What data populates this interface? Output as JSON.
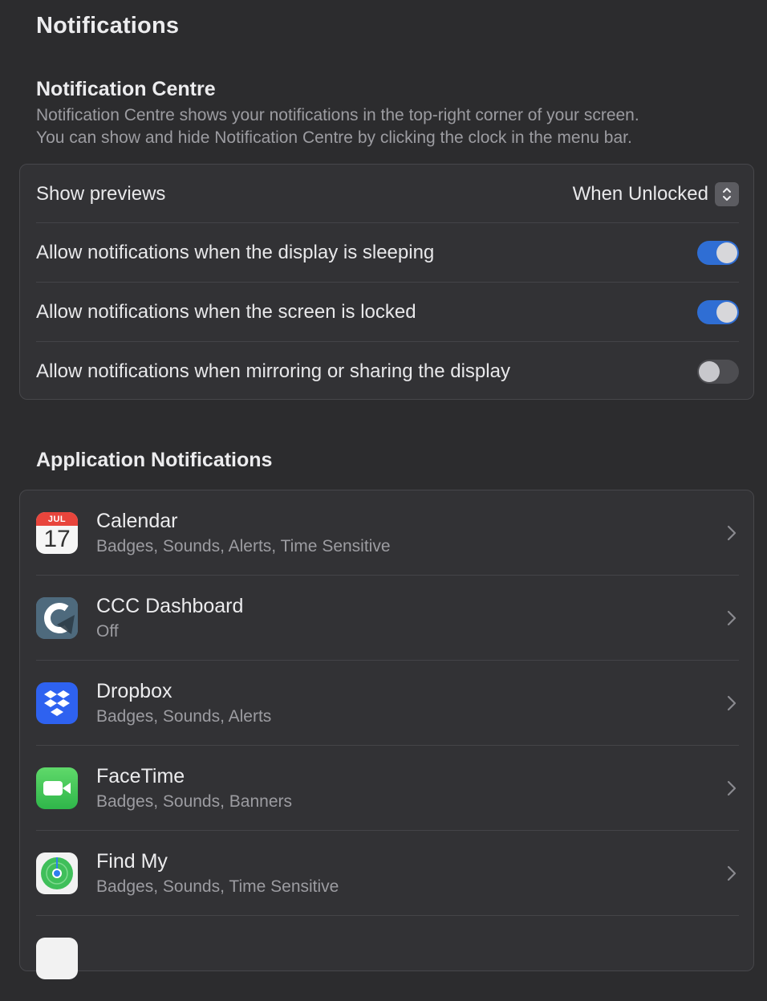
{
  "header": {
    "title": "Notifications"
  },
  "notification_centre": {
    "title": "Notification Centre",
    "description_line1": "Notification Centre shows your notifications in the top-right corner of your screen.",
    "description_line2": "You can show and hide Notification Centre by clicking the clock in the menu bar.",
    "show_previews": {
      "label": "Show previews",
      "value": "When Unlocked"
    },
    "toggles": [
      {
        "label": "Allow notifications when the display is sleeping",
        "on": true
      },
      {
        "label": "Allow notifications when the screen is locked",
        "on": true
      },
      {
        "label": "Allow notifications when mirroring or sharing the display",
        "on": false
      }
    ]
  },
  "application_notifications": {
    "title": "Application Notifications",
    "apps": [
      {
        "name": "Calendar",
        "subtitle": "Badges, Sounds, Alerts, Time Sensitive",
        "icon": "calendar-icon",
        "icon_month": "JUL",
        "icon_day": "17"
      },
      {
        "name": "CCC Dashboard",
        "subtitle": "Off",
        "icon": "ccc-dashboard-icon"
      },
      {
        "name": "Dropbox",
        "subtitle": "Badges, Sounds, Alerts",
        "icon": "dropbox-icon"
      },
      {
        "name": "FaceTime",
        "subtitle": "Badges, Sounds, Banners",
        "icon": "facetime-icon"
      },
      {
        "name": "Find My",
        "subtitle": "Badges, Sounds, Time Sensitive",
        "icon": "find-my-icon"
      }
    ]
  },
  "colors": {
    "background": "#2c2c2e",
    "card": "#323235",
    "toggle_on": "#2f6ed4",
    "toggle_off": "#4d4d51",
    "secondary_text": "#9c9ca1"
  }
}
